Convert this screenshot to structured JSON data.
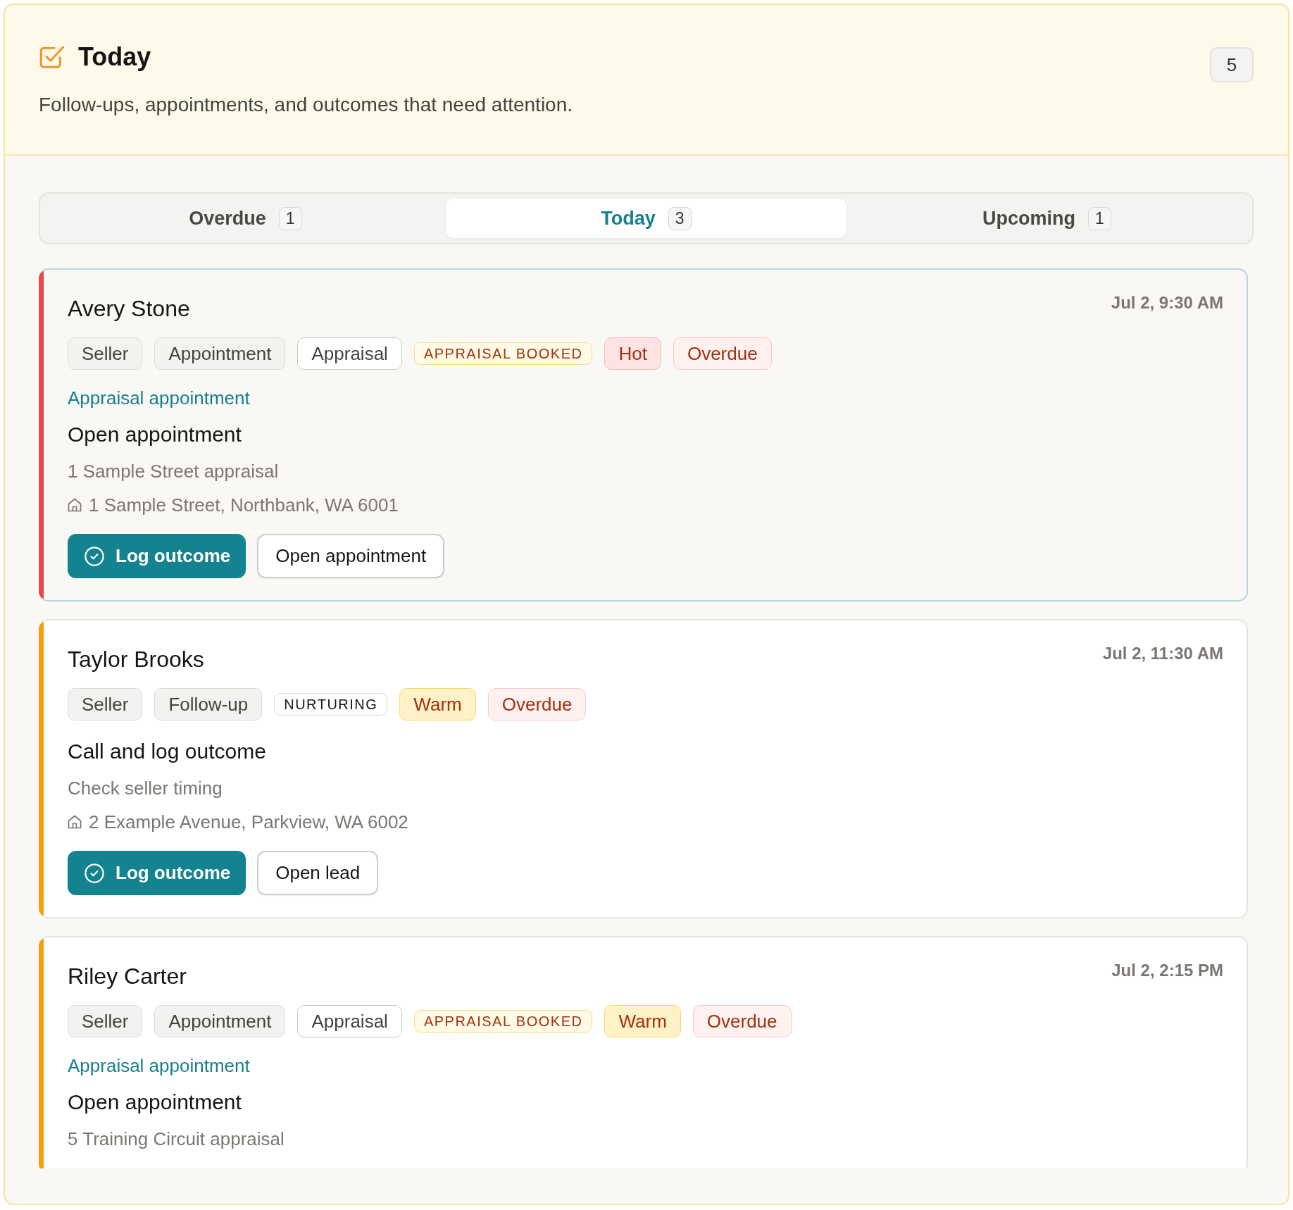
{
  "header": {
    "title": "Today",
    "subtitle": "Follow-ups, appointments, and outcomes that need attention.",
    "count": "5"
  },
  "tabs": [
    {
      "label": "Overdue",
      "count": "1",
      "selected": false
    },
    {
      "label": "Today",
      "count": "3",
      "selected": true
    },
    {
      "label": "Upcoming",
      "count": "1",
      "selected": false
    }
  ],
  "cards": [
    {
      "name": "Avery Stone",
      "time": "Jul 2, 9:30 AM",
      "selected": true,
      "color": "#e5484d",
      "tags": [
        {
          "label": "Seller",
          "kind": "chip"
        },
        {
          "label": "Appointment",
          "kind": "chip"
        },
        {
          "label": "Appraisal",
          "kind": "outline"
        },
        {
          "label": "APPRAISAL BOOKED",
          "kind": "milestone"
        },
        {
          "label": "Hot",
          "kind": "hot"
        },
        {
          "label": "Overdue",
          "kind": "overdue"
        }
      ],
      "link": "Appraisal appointment",
      "title": "Open appointment",
      "detail": "1 Sample Street appraisal",
      "address": "1 Sample Street, Northbank, WA 6001",
      "actions": [
        {
          "label": "Log outcome",
          "kind": "primary"
        },
        {
          "label": "Open appointment",
          "kind": "secondary"
        }
      ]
    },
    {
      "name": "Taylor Brooks",
      "time": "Jul 2, 11:30 AM",
      "selected": false,
      "color": "#f59e0b",
      "tags": [
        {
          "label": "Seller",
          "kind": "chip"
        },
        {
          "label": "Follow-up",
          "kind": "chip"
        },
        {
          "label": "NURTURING",
          "kind": "stage"
        },
        {
          "label": "Warm",
          "kind": "warm"
        },
        {
          "label": "Overdue",
          "kind": "overdue"
        }
      ],
      "title": "Call and log outcome",
      "detail": "Check seller timing",
      "address": "2 Example Avenue, Parkview, WA 6002",
      "actions": [
        {
          "label": "Log outcome",
          "kind": "primary"
        },
        {
          "label": "Open lead",
          "kind": "secondary"
        }
      ]
    },
    {
      "name": "Riley Carter",
      "time": "Jul 2, 2:15 PM",
      "selected": false,
      "color": "#f59e0b",
      "tags": [
        {
          "label": "Seller",
          "kind": "chip"
        },
        {
          "label": "Appointment",
          "kind": "chip"
        },
        {
          "label": "Appraisal",
          "kind": "outline"
        },
        {
          "label": "APPRAISAL BOOKED",
          "kind": "milestone"
        },
        {
          "label": "Warm",
          "kind": "warm"
        },
        {
          "label": "Overdue",
          "kind": "overdue"
        }
      ],
      "link": "Appraisal appointment",
      "title": "Open appointment",
      "detail": "5 Training Circuit appraisal"
    }
  ]
}
